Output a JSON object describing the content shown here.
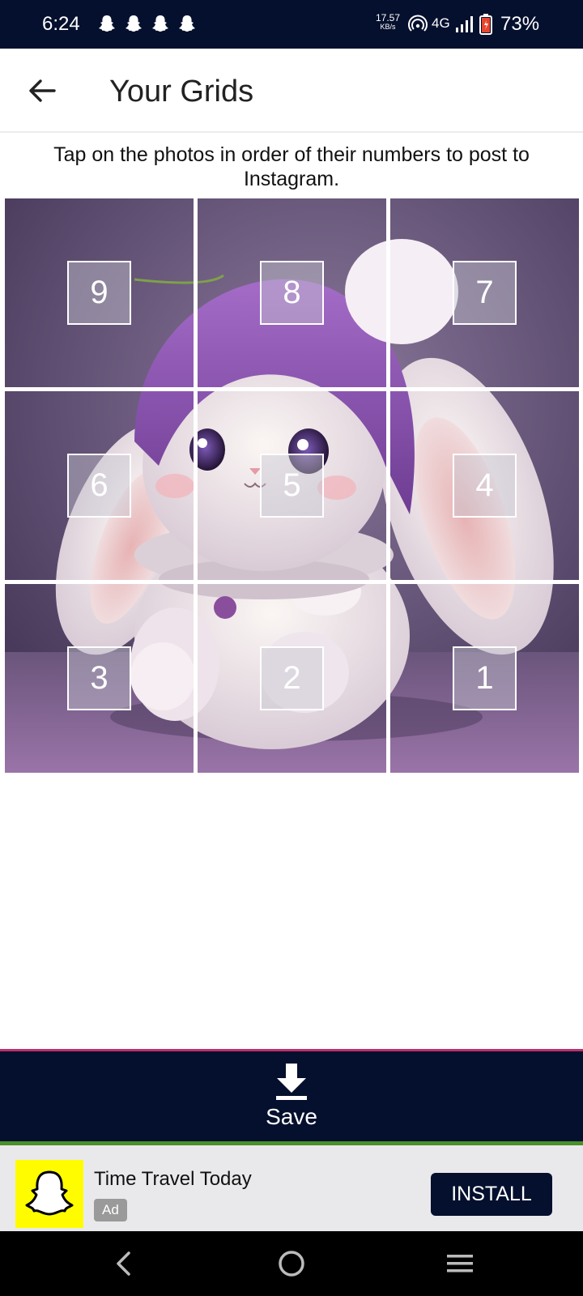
{
  "status_bar": {
    "time": "6:24",
    "notification_icons": [
      "snapchat-icon",
      "snapchat-icon",
      "snapchat-icon",
      "snapchat-icon"
    ],
    "net_speed_value": "17.57",
    "net_speed_unit": "KB/s",
    "network_type": "4G",
    "battery_percent": "73%"
  },
  "app_bar": {
    "back_icon": "arrow-left-icon",
    "title": "Your Grids"
  },
  "instruction": "Tap on the photos in order of their numbers to post to Instagram.",
  "grid": {
    "rows": 3,
    "columns": 3,
    "image": "cute fluffy bunny wearing a purple knit hat",
    "tiles": [
      {
        "row": 0,
        "col": 0,
        "number": "9"
      },
      {
        "row": 0,
        "col": 1,
        "number": "8"
      },
      {
        "row": 0,
        "col": 2,
        "number": "7"
      },
      {
        "row": 1,
        "col": 0,
        "number": "6"
      },
      {
        "row": 1,
        "col": 1,
        "number": "5"
      },
      {
        "row": 1,
        "col": 2,
        "number": "4"
      },
      {
        "row": 2,
        "col": 0,
        "number": "3"
      },
      {
        "row": 2,
        "col": 1,
        "number": "2"
      },
      {
        "row": 2,
        "col": 2,
        "number": "1"
      }
    ]
  },
  "save_bar": {
    "icon": "download-icon",
    "label": "Save"
  },
  "ad": {
    "logo": "snapchat-ghost-logo",
    "title": "Time Travel Today",
    "badge": "Ad",
    "install_label": "INSTALL"
  },
  "nav_bar": {
    "buttons": [
      "back-icon",
      "home-icon",
      "recents-icon"
    ]
  },
  "colors": {
    "primary_dark": "#05102e",
    "save_top_border": "#c0306a",
    "save_accent": "#4a8f2a",
    "snapchat_yellow": "#fffc00",
    "ad_background": "#e9e9ec"
  }
}
